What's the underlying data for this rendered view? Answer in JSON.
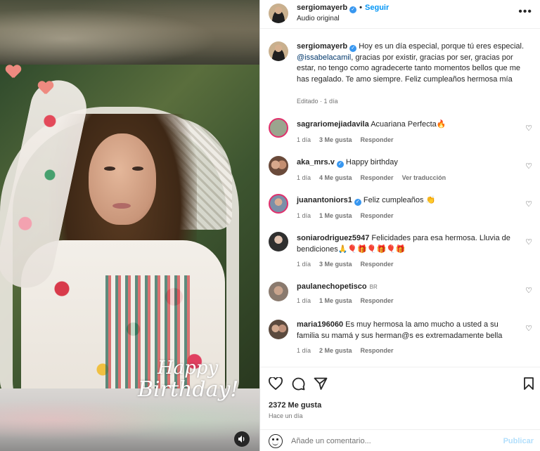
{
  "post": {
    "username": "sergiomayerb",
    "audio": "Audio original",
    "follow_label": "Seguir",
    "more_label": "•••",
    "caption_user": "sergiomayerb",
    "caption_part1": " Hoy es un día especial, porque tú eres especial. ",
    "caption_mention": "@issabelacamil",
    "caption_part2": ", gracias por existir, gracias por ser, gracias por estar, no tengo como agradecerte tanto momentos bellos que me has regalado. Te amo siempre. Feliz cumpleaños hermosa mía",
    "caption_meta": "Editado · 1 día",
    "overlay_line1": "Happy",
    "overlay_line2": "Birthday!"
  },
  "comments": [
    {
      "user": "sagrariomejiadavila",
      "text": "Acuariana Perfecta🔥",
      "time": "1 día",
      "likes": "3 Me gusta",
      "reply": "Responder",
      "extra": ""
    },
    {
      "user": "aka_mrs.v",
      "text": "Happy birthday",
      "time": "1 día",
      "likes": "4 Me gusta",
      "reply": "Responder",
      "extra": "Ver traducción"
    },
    {
      "user": "juanantoniors1",
      "text": "Feliz cumpleaños 👏",
      "time": "1 día",
      "likes": "1 Me gusta",
      "reply": "Responder",
      "extra": ""
    },
    {
      "user": "soniarodriguez5947",
      "text": "Felicidades para esa hermosa. Lluvia de bendiciones🙏🎈🎁🎈🎁🎈🎁",
      "time": "1 día",
      "likes": "3 Me gusta",
      "reply": "Responder",
      "extra": ""
    },
    {
      "user": "paulanechopetisco",
      "tag": "BR",
      "text": "",
      "time": "1 día",
      "likes": "1 Me gusta",
      "reply": "Responder",
      "extra": ""
    },
    {
      "user": "maria196060",
      "text": "Es muy hermosa la amo mucho a usted a su familia su mamá y sus herman@s es extremadamente bella",
      "time": "1 día",
      "likes": "2 Me gusta",
      "reply": "Responder",
      "extra": ""
    }
  ],
  "footer": {
    "likes": "2372 Me gusta",
    "ago": "Hace un día",
    "comment_placeholder": "Añade un comentario...",
    "publish_label": "Publicar"
  },
  "icons": {
    "like": "heart-icon",
    "comment": "comment-bubble-icon",
    "share": "paper-plane-icon",
    "save": "bookmark-icon",
    "emoji": "smiley-icon",
    "sound": "speaker-icon"
  },
  "colors": {
    "accent": "#0095f6",
    "verified": "#3897f0",
    "publish_disabled": "#b2dffc",
    "muted_text": "#737373"
  }
}
